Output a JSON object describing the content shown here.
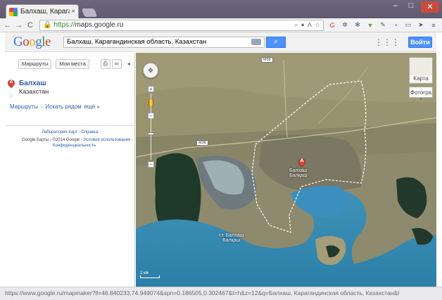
{
  "browser": {
    "tab_title": "Балхаш, Карагандинска",
    "tab_close": "×",
    "window_controls": {
      "min": "–",
      "max": "□",
      "close": "✕"
    },
    "nav": {
      "back": "←",
      "forward": "→",
      "reload": "C"
    },
    "url_scheme": "https://",
    "url_host": "maps.google.ru",
    "status_url": "https://www.google.ru/mapmaker?ll=46.840233,74.949074&spn=0.186505,0.302467&t=h&z=12&q=Балхаш, Карагандинская область, Казахстан&hl=ru"
  },
  "header": {
    "logo": [
      "G",
      "o",
      "o",
      "g",
      "l",
      "e"
    ],
    "search_value": "Балхаш, Карагандинская область, Казахстан",
    "signin_label": "Войти",
    "apps_icon": "⋮⋮⋮"
  },
  "panel": {
    "routes_button": "Маршруты",
    "my_places_button": "Мои места",
    "result": {
      "marker_letter": "A",
      "title": "Балхаш",
      "subtitle": "Казахстан",
      "links": [
        "Маршруты",
        "-",
        "Искать рядом",
        "ещё »"
      ]
    },
    "footer_links": "Лаборатория Карт - Справка",
    "footer_line1_prefix": "Google Карты",
    "footer_line1_sep": " - ",
    "footer_line1_copy": "©2014 Google",
    "footer_line1_link": " - Условия использования -",
    "footer_line2": "Конфиденциальность"
  },
  "map": {
    "road_labels": [
      "M36",
      "M36"
    ],
    "city_label_main": "Балхаш",
    "city_label_sub": "Балқаш",
    "city_marker_letter": "A",
    "station_label_1": "ст. Балхаш",
    "station_label_2": "Балқаш",
    "maptype_map": "Карта",
    "maptype_satellite": "Фотогра",
    "scale_label": "2 км"
  }
}
